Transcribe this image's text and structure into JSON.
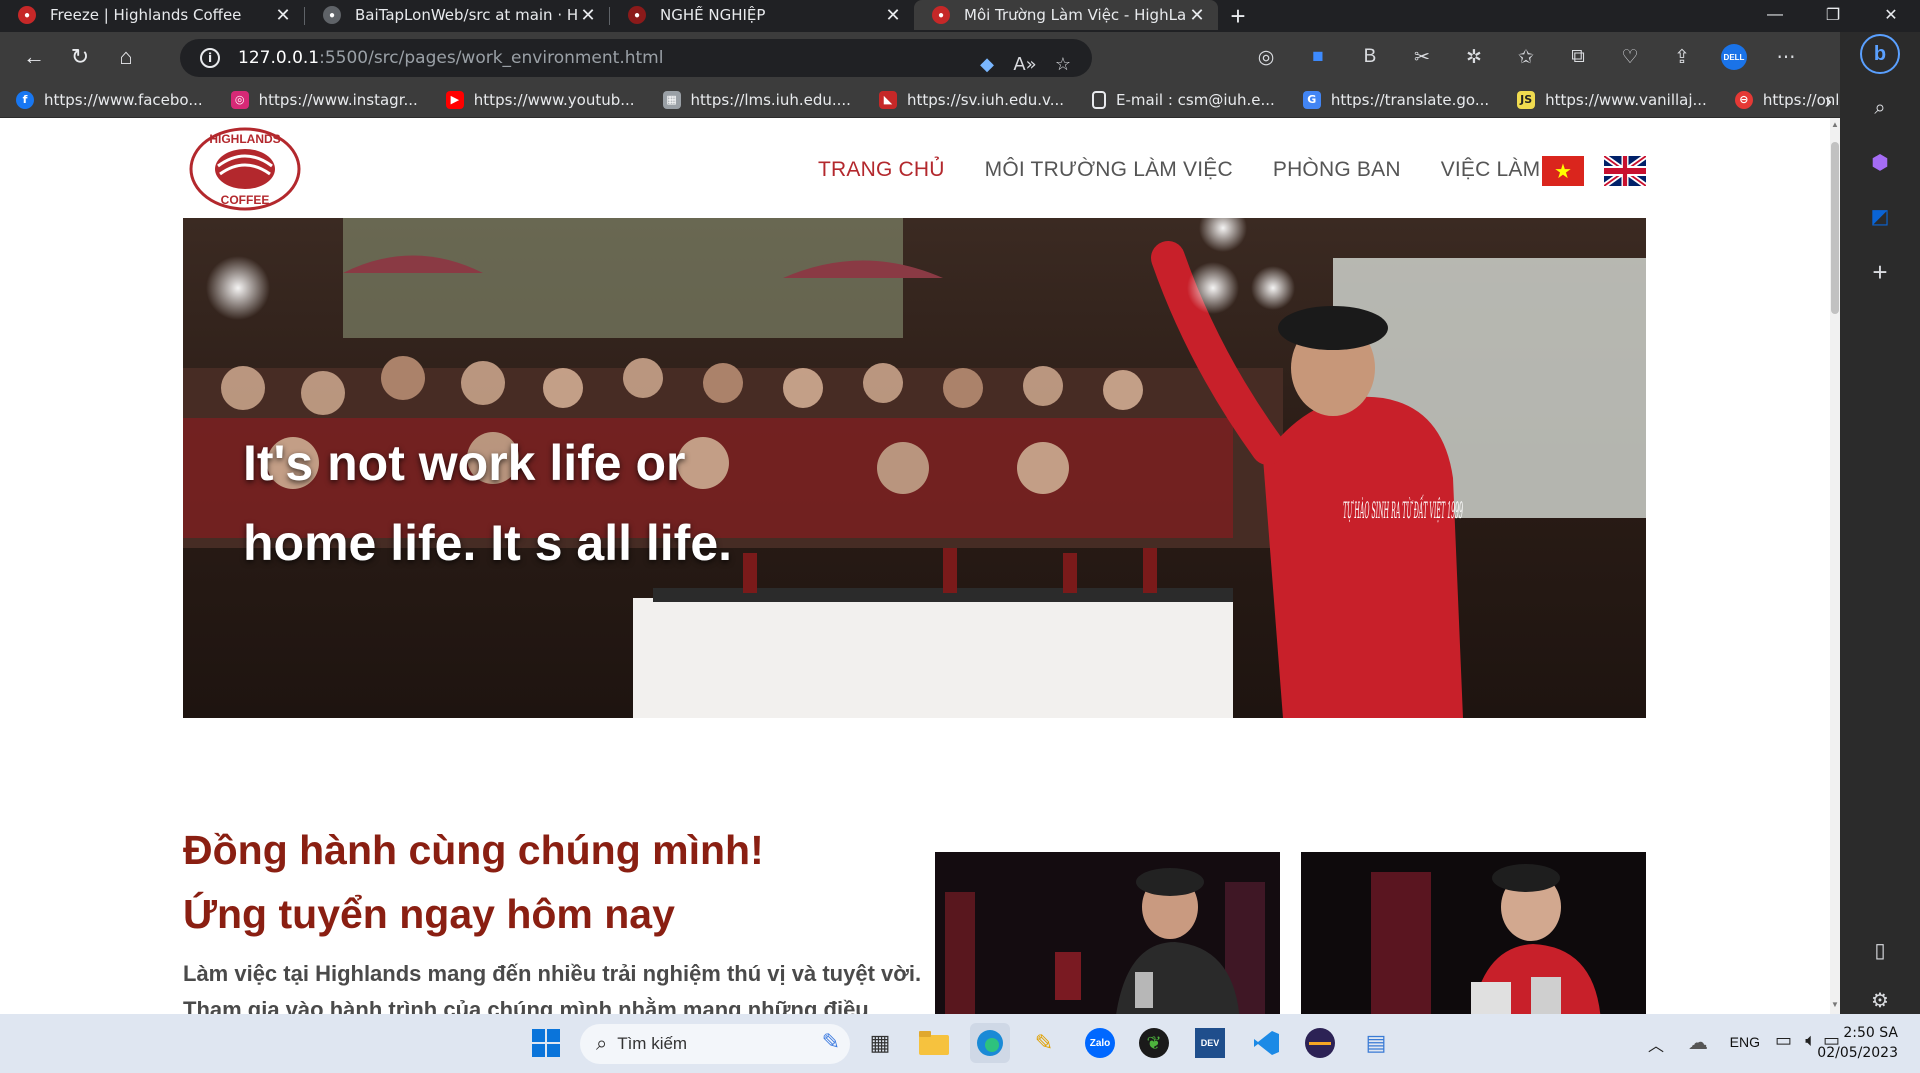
{
  "tabs": [
    {
      "title": "Freeze | Highlands Coffee",
      "active": false
    },
    {
      "title": "BaiTapLonWeb/src at main · Hoai",
      "active": false
    },
    {
      "title": "NGHỀ NGHIỆP",
      "active": false
    },
    {
      "title": "Môi Trường Làm Việc - HighLands",
      "active": true
    }
  ],
  "address": {
    "host": "127.0.0.1",
    "path": ":5500/src/pages/work_environment.html"
  },
  "bookmarks": [
    {
      "label": "https://www.facebo...",
      "icon": "facebook-icon",
      "color": "#1877f2"
    },
    {
      "label": "https://www.instagr...",
      "icon": "instagram-icon",
      "color": "#d62976"
    },
    {
      "label": "https://www.youtub...",
      "icon": "youtube-icon",
      "color": "#ff0000"
    },
    {
      "label": "https://lms.iuh.edu....",
      "icon": "lms-icon",
      "color": "#9aa0a6"
    },
    {
      "label": "https://sv.iuh.edu.v...",
      "icon": "iuh-icon",
      "color": "#c62828"
    },
    {
      "label": "E-mail : csm@iuh.e...",
      "icon": "document-icon",
      "color": "#5f6368"
    },
    {
      "label": "https://translate.go...",
      "icon": "translate-icon",
      "color": "#4285f4"
    },
    {
      "label": "https://www.vanillaj...",
      "icon": "js-icon",
      "color": "#f0db4f"
    },
    {
      "label": "https://onlinestudy....",
      "icon": "onlinestudy-icon",
      "color": "#e53935"
    }
  ],
  "site": {
    "nav": [
      {
        "label": "TRANG CHỦ",
        "active": true
      },
      {
        "label": "MÔI TRƯỜNG LÀM VIỆC",
        "active": false
      },
      {
        "label": "PHÒNG BAN",
        "active": false
      },
      {
        "label": "VIỆC LÀM",
        "active": false
      }
    ],
    "logo_top": "HIGHLANDS",
    "logo_bottom": "COFFEE",
    "hero_line1": "It's not work life or",
    "hero_line2": "home life. It s all life.",
    "hero_shirt_text": "TỰ HÀO SINH RA TỪ ĐẤT VIỆT 1999",
    "join_title_1": "Đồng hành cùng chúng mình!",
    "join_title_2": "Ứng tuyển ngay hôm nay",
    "join_desc": "Làm việc tại Highlands mang đến nhiều trải nghiệm thú vị và tuyệt vời. Tham gia vào hành trình của chúng mình nhằm mang những điều",
    "brand_color": "#b3282d",
    "title_color": "#8a1f12"
  },
  "taskbar": {
    "search_label": "Tìm kiếm",
    "lang": "ENG",
    "time": "2:50 SA",
    "date": "02/05/2023"
  }
}
